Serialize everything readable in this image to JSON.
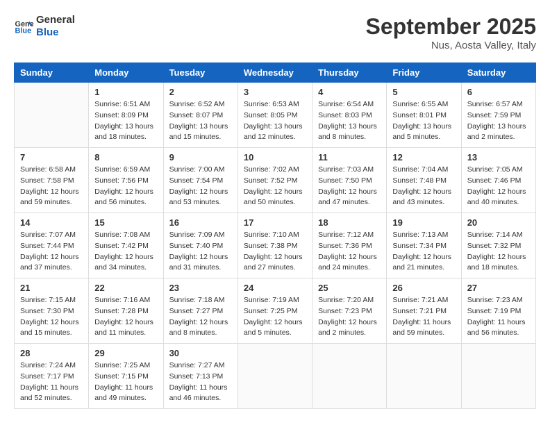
{
  "logo": {
    "line1": "General",
    "line2": "Blue"
  },
  "title": "September 2025",
  "location": "Nus, Aosta Valley, Italy",
  "days_header": [
    "Sunday",
    "Monday",
    "Tuesday",
    "Wednesday",
    "Thursday",
    "Friday",
    "Saturday"
  ],
  "weeks": [
    [
      {
        "day": "",
        "info": ""
      },
      {
        "day": "1",
        "info": "Sunrise: 6:51 AM\nSunset: 8:09 PM\nDaylight: 13 hours\nand 18 minutes."
      },
      {
        "day": "2",
        "info": "Sunrise: 6:52 AM\nSunset: 8:07 PM\nDaylight: 13 hours\nand 15 minutes."
      },
      {
        "day": "3",
        "info": "Sunrise: 6:53 AM\nSunset: 8:05 PM\nDaylight: 13 hours\nand 12 minutes."
      },
      {
        "day": "4",
        "info": "Sunrise: 6:54 AM\nSunset: 8:03 PM\nDaylight: 13 hours\nand 8 minutes."
      },
      {
        "day": "5",
        "info": "Sunrise: 6:55 AM\nSunset: 8:01 PM\nDaylight: 13 hours\nand 5 minutes."
      },
      {
        "day": "6",
        "info": "Sunrise: 6:57 AM\nSunset: 7:59 PM\nDaylight: 13 hours\nand 2 minutes."
      }
    ],
    [
      {
        "day": "7",
        "info": "Sunrise: 6:58 AM\nSunset: 7:58 PM\nDaylight: 12 hours\nand 59 minutes."
      },
      {
        "day": "8",
        "info": "Sunrise: 6:59 AM\nSunset: 7:56 PM\nDaylight: 12 hours\nand 56 minutes."
      },
      {
        "day": "9",
        "info": "Sunrise: 7:00 AM\nSunset: 7:54 PM\nDaylight: 12 hours\nand 53 minutes."
      },
      {
        "day": "10",
        "info": "Sunrise: 7:02 AM\nSunset: 7:52 PM\nDaylight: 12 hours\nand 50 minutes."
      },
      {
        "day": "11",
        "info": "Sunrise: 7:03 AM\nSunset: 7:50 PM\nDaylight: 12 hours\nand 47 minutes."
      },
      {
        "day": "12",
        "info": "Sunrise: 7:04 AM\nSunset: 7:48 PM\nDaylight: 12 hours\nand 43 minutes."
      },
      {
        "day": "13",
        "info": "Sunrise: 7:05 AM\nSunset: 7:46 PM\nDaylight: 12 hours\nand 40 minutes."
      }
    ],
    [
      {
        "day": "14",
        "info": "Sunrise: 7:07 AM\nSunset: 7:44 PM\nDaylight: 12 hours\nand 37 minutes."
      },
      {
        "day": "15",
        "info": "Sunrise: 7:08 AM\nSunset: 7:42 PM\nDaylight: 12 hours\nand 34 minutes."
      },
      {
        "day": "16",
        "info": "Sunrise: 7:09 AM\nSunset: 7:40 PM\nDaylight: 12 hours\nand 31 minutes."
      },
      {
        "day": "17",
        "info": "Sunrise: 7:10 AM\nSunset: 7:38 PM\nDaylight: 12 hours\nand 27 minutes."
      },
      {
        "day": "18",
        "info": "Sunrise: 7:12 AM\nSunset: 7:36 PM\nDaylight: 12 hours\nand 24 minutes."
      },
      {
        "day": "19",
        "info": "Sunrise: 7:13 AM\nSunset: 7:34 PM\nDaylight: 12 hours\nand 21 minutes."
      },
      {
        "day": "20",
        "info": "Sunrise: 7:14 AM\nSunset: 7:32 PM\nDaylight: 12 hours\nand 18 minutes."
      }
    ],
    [
      {
        "day": "21",
        "info": "Sunrise: 7:15 AM\nSunset: 7:30 PM\nDaylight: 12 hours\nand 15 minutes."
      },
      {
        "day": "22",
        "info": "Sunrise: 7:16 AM\nSunset: 7:28 PM\nDaylight: 12 hours\nand 11 minutes."
      },
      {
        "day": "23",
        "info": "Sunrise: 7:18 AM\nSunset: 7:27 PM\nDaylight: 12 hours\nand 8 minutes."
      },
      {
        "day": "24",
        "info": "Sunrise: 7:19 AM\nSunset: 7:25 PM\nDaylight: 12 hours\nand 5 minutes."
      },
      {
        "day": "25",
        "info": "Sunrise: 7:20 AM\nSunset: 7:23 PM\nDaylight: 12 hours\nand 2 minutes."
      },
      {
        "day": "26",
        "info": "Sunrise: 7:21 AM\nSunset: 7:21 PM\nDaylight: 11 hours\nand 59 minutes."
      },
      {
        "day": "27",
        "info": "Sunrise: 7:23 AM\nSunset: 7:19 PM\nDaylight: 11 hours\nand 56 minutes."
      }
    ],
    [
      {
        "day": "28",
        "info": "Sunrise: 7:24 AM\nSunset: 7:17 PM\nDaylight: 11 hours\nand 52 minutes."
      },
      {
        "day": "29",
        "info": "Sunrise: 7:25 AM\nSunset: 7:15 PM\nDaylight: 11 hours\nand 49 minutes."
      },
      {
        "day": "30",
        "info": "Sunrise: 7:27 AM\nSunset: 7:13 PM\nDaylight: 11 hours\nand 46 minutes."
      },
      {
        "day": "",
        "info": ""
      },
      {
        "day": "",
        "info": ""
      },
      {
        "day": "",
        "info": ""
      },
      {
        "day": "",
        "info": ""
      }
    ]
  ]
}
